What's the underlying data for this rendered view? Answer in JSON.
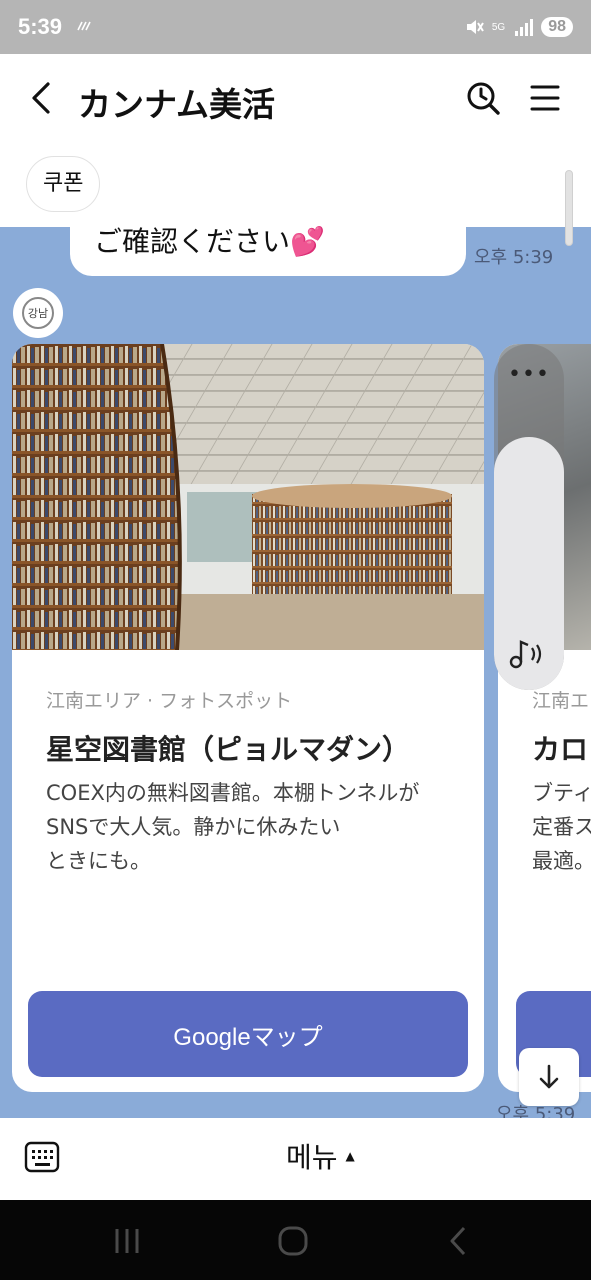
{
  "status_bar": {
    "time": "5:39",
    "network": "5G",
    "battery": "98"
  },
  "header": {
    "title": "カンナム美活",
    "back_icon": "chevron-left-icon",
    "search_icon": "clock-search-icon",
    "menu_icon": "hamburger-menu-icon"
  },
  "coupon_chip": "쿠폰",
  "messages": [
    {
      "text": "ご確認ください💕",
      "time": "오후 5:39"
    }
  ],
  "avatar_text": "강남",
  "cards": [
    {
      "category": "江南エリア · フォトスポット",
      "title": "星空図書館（ピョルマダン）",
      "description": [
        "COEX内の無料図書館。本棚トンネルが",
        "SNSで大人気。静かに休みたい",
        "ときにも。"
      ],
      "button": "Googleマップ"
    },
    {
      "category": "江南エ",
      "title": "カロ",
      "description": [
        "ブティ",
        "定番ス",
        "最適。"
      ]
    }
  ],
  "volume": {
    "level": 0.73,
    "more_label": "•••"
  },
  "last_message_time": "오후 5:39",
  "bottom_bar": {
    "menu_label": "메뉴",
    "menu_caret": "▲"
  },
  "colors": {
    "chat_background": "#8aabd8",
    "button": "#5a6bc2",
    "status_bar": "#b5b5b5"
  }
}
